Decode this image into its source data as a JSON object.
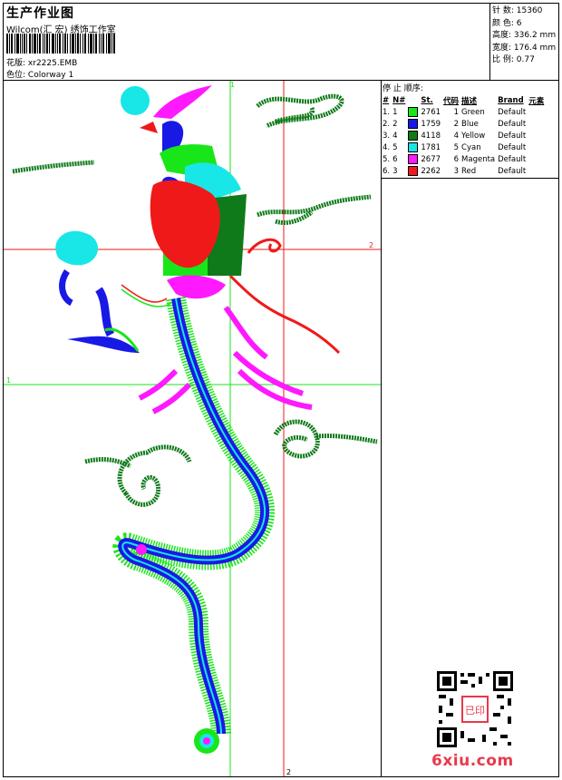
{
  "header": {
    "title": "生产作业图",
    "studio": "Wilcom(汇 宏) 绣饰工作室",
    "design_label": "花版:",
    "design_file": "xr2225.EMB",
    "color_label": "色位:",
    "colorway": "Colorway 1"
  },
  "stats": {
    "stitches_label": "针 数:",
    "stitches": "15360",
    "colors_label": "颜 色:",
    "colors": "6",
    "height_label": "高度:",
    "height": "336.2 mm",
    "width_label": "宽度:",
    "width": "176.4 mm",
    "scale_label": "比 例:",
    "scale": "0.77"
  },
  "legend": {
    "title": "停 止 顺序:",
    "headers": {
      "index": "#",
      "no": "N#",
      "st": "St.",
      "code": "代码",
      "desc": "描述",
      "brand": "Brand",
      "element": "元素"
    },
    "rows": [
      {
        "index": "1.",
        "no": "1",
        "color": "#19e619",
        "st": "2761",
        "code": "1",
        "desc": "Green",
        "brand": "Default"
      },
      {
        "index": "2.",
        "no": "2",
        "color": "#1919e6",
        "st": "1759",
        "code": "2",
        "desc": "Blue",
        "brand": "Default"
      },
      {
        "index": "3.",
        "no": "4",
        "color": "#0f7a19",
        "st": "4118",
        "code": "4",
        "desc": "Yellow",
        "brand": "Default"
      },
      {
        "index": "4.",
        "no": "5",
        "color": "#19e6e6",
        "st": "1781",
        "code": "5",
        "desc": "Cyan",
        "brand": "Default"
      },
      {
        "index": "5.",
        "no": "6",
        "color": "#ff19ff",
        "st": "2677",
        "code": "6",
        "desc": "Magenta",
        "brand": "Default"
      },
      {
        "index": "6.",
        "no": "3",
        "color": "#f01919",
        "st": "2262",
        "code": "3",
        "desc": "Red",
        "brand": "Default"
      }
    ]
  },
  "guides": {
    "v1_label": "1",
    "v2_label": "2",
    "h1_label": "1",
    "h2_label": "2"
  },
  "colors": {
    "green": "#19e619",
    "blue": "#1919e6",
    "dark_green": "#0f7a19",
    "cyan": "#19e6e6",
    "magenta": "#ff19ff",
    "red": "#f01919"
  },
  "watermark": {
    "site": "6xiu.com",
    "seal": "已印"
  }
}
